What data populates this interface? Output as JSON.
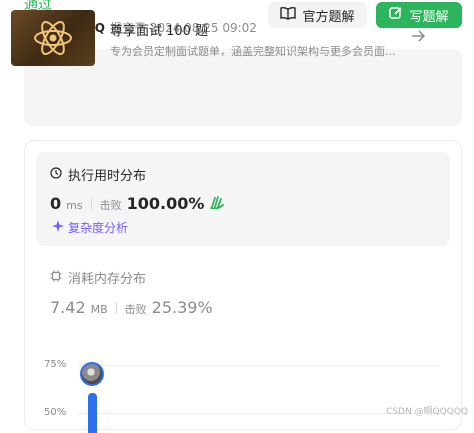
{
  "header": {
    "status": "通过",
    "username": "啊QQQQQ",
    "submit_meta": "提交于 2024.08.25 09:02",
    "official_solution_label": "官方题解",
    "write_solution_label": "写题解"
  },
  "promo": {
    "title": "尊享面试 100 题",
    "description": "专为会员定制面试题单，涵盖完整知识架构与更多会员面..."
  },
  "runtime": {
    "heading": "执行用时分布",
    "value": "0",
    "unit": "ms",
    "beat_label": "击败",
    "beat_value": "100.00%",
    "complexity_label": "复杂度分析"
  },
  "memory": {
    "heading": "消耗内存分布",
    "value": "7.42",
    "unit": "MB",
    "beat_label": "击败",
    "beat_value": "25.39%"
  },
  "chart_data": {
    "type": "bar",
    "yticks": [
      "75%",
      "50%"
    ],
    "series": [
      {
        "values": [
          0.6
        ]
      }
    ],
    "ylim": [
      0.5,
      0.75
    ],
    "grid": true
  },
  "watermark": "CSDN @啊QQQQQ",
  "colors": {
    "accent_green": "#2db55d",
    "complexity_purple": "#7b5cff",
    "bar_blue": "#2f6fed"
  }
}
